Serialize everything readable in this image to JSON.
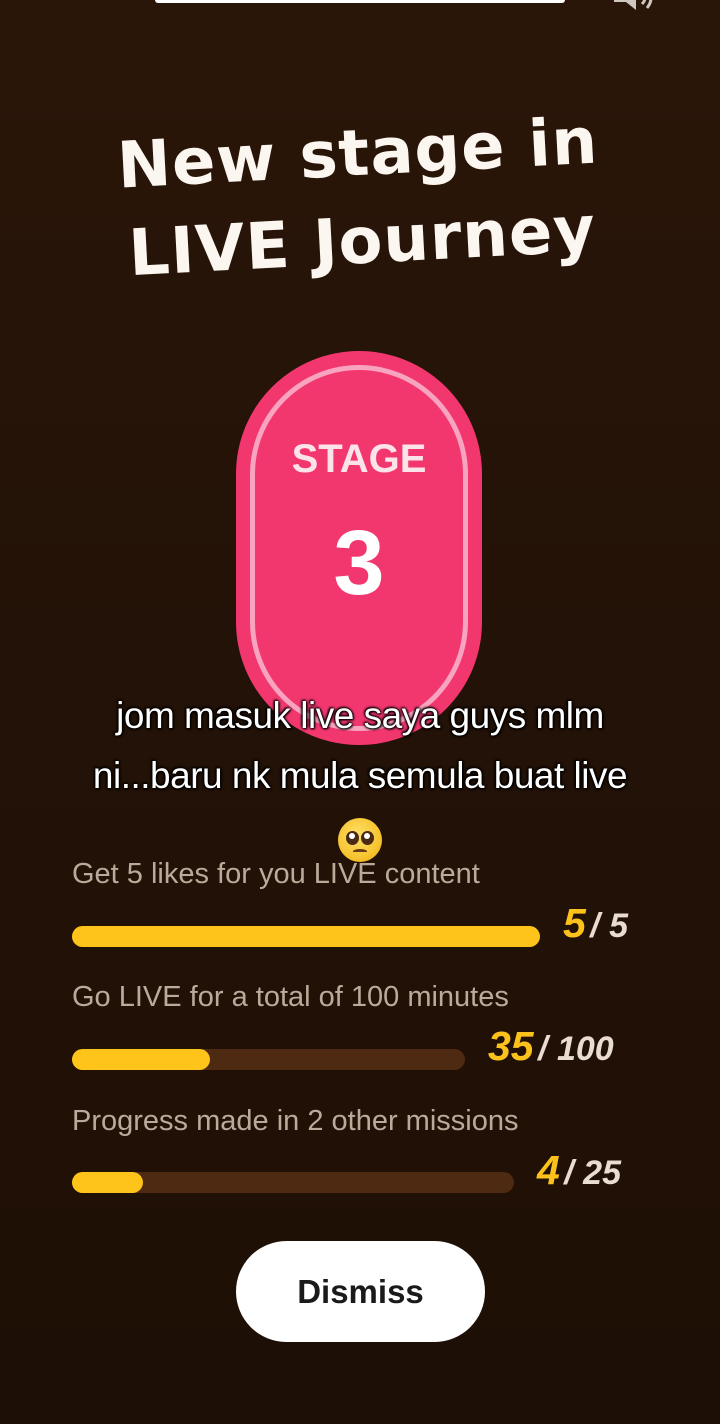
{
  "title": {
    "line1": "New stage in",
    "line2": "LIVE Journey"
  },
  "badge": {
    "label": "STAGE",
    "number": "3"
  },
  "caption": {
    "line1": "jom masuk live saya guys mlm",
    "line2": "ni...baru nk mula semula buat live",
    "emoji": "pleading-face"
  },
  "missions": [
    {
      "label": "Get 5 likes for you LIVE content",
      "current": "5",
      "total": "/ 5",
      "progress": 1.0
    },
    {
      "label": "Go LIVE for a total of 100 minutes",
      "current": "35",
      "total": "/ 100",
      "progress": 0.35
    },
    {
      "label": "Progress made in 2 other missions",
      "current": "4",
      "total": "/ 25",
      "progress": 0.16
    }
  ],
  "dismiss_label": "Dismiss",
  "colors": {
    "accent": "#fec419",
    "badge": "#f2376f",
    "track": "#4e2a12",
    "background": "#231207"
  }
}
